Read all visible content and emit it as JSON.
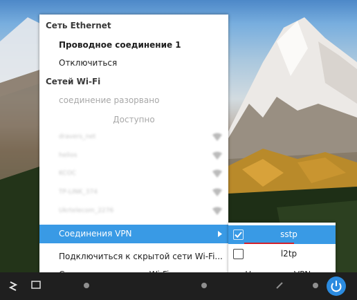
{
  "network_menu": {
    "ethernet_header": "Сеть Ethernet",
    "wired_connection": "Проводное соединение 1",
    "disconnect": "Отключиться",
    "wifi_header": "Сетей Wi-Fi",
    "wifi_status": "соединение разорвано",
    "available_label": "Доступно",
    "wifi_networks": [
      {
        "ssid": "dravers_net"
      },
      {
        "ssid": "helios"
      },
      {
        "ssid": "KCOC"
      },
      {
        "ssid": "TP-LINK_374"
      },
      {
        "ssid": "Ukrtelecom_2276"
      }
    ],
    "vpn_connections": "Соединения VPN",
    "connect_hidden": "Подключиться к скрытой сети Wi-Fi...",
    "create_new": "Создать новую сеть Wi-Fi..."
  },
  "vpn_submenu": {
    "items": [
      {
        "label": "sstp",
        "checked": true
      },
      {
        "label": "l2tp",
        "checked": false
      }
    ],
    "configure": "Настроить VPN..."
  },
  "colors": {
    "highlight": "#399ae5",
    "underline": "#d3202a",
    "power_button": "#2b8be0"
  }
}
